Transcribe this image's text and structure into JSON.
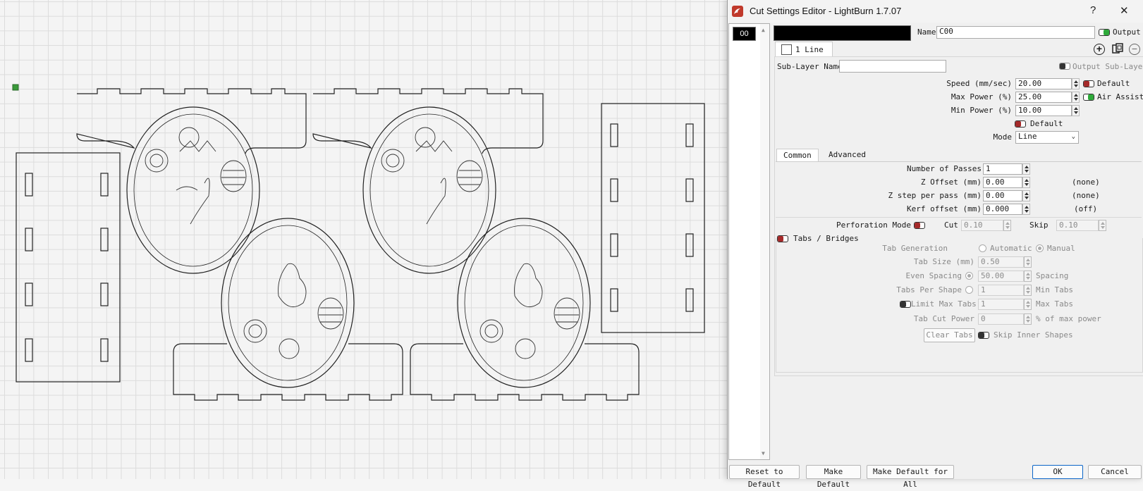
{
  "window": {
    "title": "Cut Settings Editor - LightBurn 1.7.07",
    "help_glyph": "?",
    "close_glyph": "✕",
    "app_icon": "lightburn-icon"
  },
  "layers": [
    {
      "label": "00",
      "color": "#000000"
    }
  ],
  "header": {
    "layer_color": "#000000",
    "name_label": "Name",
    "name_value": "C00",
    "output_label": "Output",
    "output_on": true
  },
  "sublayer": {
    "tab_label": "1 Line",
    "name_label": "Sub-Layer Name",
    "name_value": "",
    "output_sublayer_label": "Output Sub-Layer",
    "add_icon": "plus-circle-icon",
    "copy_icon": "copy-icon",
    "remove_icon": "minus-circle-icon"
  },
  "power": {
    "speed_label": "Speed (mm/sec)",
    "speed_value": "20.00",
    "speed_default_label": "Default",
    "max_power_label": "Max Power (%)",
    "max_power_value": "25.00",
    "air_assist_label": "Air Assist",
    "min_power_label": "Min Power (%)",
    "min_power_value": "10.00",
    "min_default_label": "Default",
    "mode_label": "Mode",
    "mode_value": "Line"
  },
  "tabs": [
    "Common",
    "Advanced"
  ],
  "common": {
    "passes_label": "Number of Passes",
    "passes_value": "1",
    "z_offset_label": "Z Offset (mm)",
    "z_offset_value": "0.00",
    "z_offset_note": "(none)",
    "z_step_label": "Z step per pass (mm)",
    "z_step_value": "0.00",
    "z_step_note": "(none)",
    "kerf_label": "Kerf offset (mm)",
    "kerf_value": "0.000",
    "kerf_note": "(off)",
    "perforation_label": "Perforation Mode",
    "cut_label": "Cut",
    "cut_value": "0.10",
    "skip_label": "Skip",
    "skip_value": "0.10"
  },
  "tabs_bridges": {
    "title": "Tabs / Bridges",
    "generation_label": "Tab Generation",
    "automatic_label": "Automatic",
    "manual_label": "Manual",
    "tab_size_label": "Tab Size (mm)",
    "tab_size_value": "0.50",
    "even_spacing_label": "Even Spacing",
    "even_spacing_value": "50.00",
    "spacing_label": "Spacing",
    "tabs_per_shape_label": "Tabs Per Shape",
    "tabs_per_shape_value": "1",
    "min_tabs_label": "Min Tabs",
    "limit_max_label": "Limit Max Tabs",
    "limit_max_value": "1",
    "max_tabs_label": "Max Tabs",
    "cut_power_label": "Tab Cut Power",
    "cut_power_value": "0",
    "cut_power_unit": "% of max power",
    "clear_tabs_label": "Clear Tabs",
    "skip_inner_label": "Skip Inner Shapes"
  },
  "footer": {
    "reset_label": "Reset to Default",
    "make_default_label": "Make Default",
    "make_default_all_label": "Make Default for All",
    "ok_label": "OK",
    "cancel_label": "Cancel"
  },
  "colors": {
    "toggle_on": "#2eaa3a",
    "toggle_red": "#a52a2a",
    "accent_ok_border": "#0a64c8"
  }
}
